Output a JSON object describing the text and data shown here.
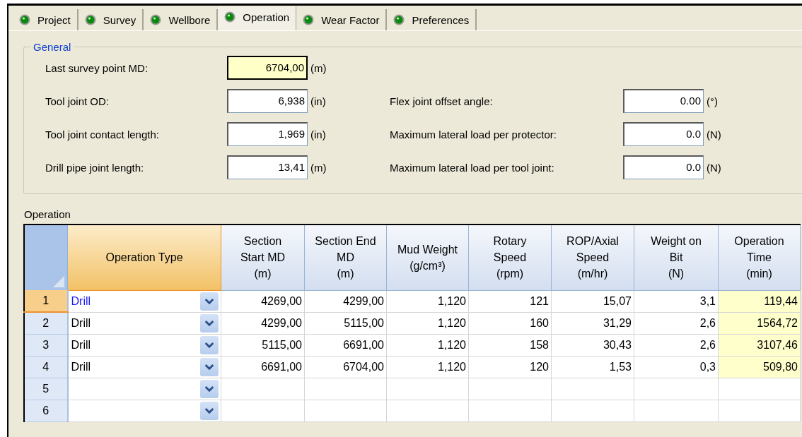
{
  "tabs": [
    {
      "label": "Project",
      "selected": false
    },
    {
      "label": "Survey",
      "selected": false
    },
    {
      "label": "Wellbore",
      "selected": false
    },
    {
      "label": "Operation",
      "selected": true
    },
    {
      "label": "Wear Factor",
      "selected": false
    },
    {
      "label": "Preferences",
      "selected": false
    }
  ],
  "general": {
    "title": "General",
    "rows": [
      {
        "left": {
          "label": "Last survey point MD:",
          "value": "6704,00",
          "unit": "(m)",
          "readonly": true
        }
      },
      {
        "left": {
          "label": "Tool joint OD:",
          "value": "6,938",
          "unit": "(in)",
          "readonly": false
        },
        "right": {
          "label": "Flex joint offset angle:",
          "value": "0.00",
          "unit": "(°)",
          "readonly": false
        }
      },
      {
        "left": {
          "label": "Tool joint contact length:",
          "value": "1,969",
          "unit": "(in)",
          "readonly": false
        },
        "right": {
          "label": "Maximum lateral load per protector:",
          "value": "0.0",
          "unit": "(N)",
          "readonly": false
        }
      },
      {
        "left": {
          "label": "Drill pipe joint length:",
          "value": "13,41",
          "unit": "(m)",
          "readonly": false
        },
        "right": {
          "label": "Maximum lateral load per tool joint:",
          "value": "0.0",
          "unit": "(N)",
          "readonly": false
        }
      }
    ]
  },
  "operation": {
    "title": "Operation",
    "columns": [
      {
        "label": "Operation Type",
        "kind": "combo",
        "selected": true
      },
      {
        "label": "Section\nStart  MD\n(m)",
        "kind": "number",
        "selected": false
      },
      {
        "label": "Section End\nMD\n(m)",
        "kind": "number",
        "selected": false
      },
      {
        "label": "Mud Weight\n(g/cm³)",
        "kind": "number",
        "selected": false
      },
      {
        "label": "Rotary\nSpeed\n(rpm)",
        "kind": "number",
        "selected": false
      },
      {
        "label": "ROP/Axial\nSpeed\n(m/hr)",
        "kind": "number",
        "selected": false
      },
      {
        "label": "Weight on\nBit\n(N)",
        "kind": "number",
        "selected": false
      },
      {
        "label": "Operation\nTime\n(min)",
        "kind": "computed",
        "selected": false
      }
    ],
    "rows": [
      {
        "number": "1",
        "selected": true,
        "cells": [
          "Drill",
          "4269,00",
          "4299,00",
          "1,120",
          "121",
          "15,07",
          "3,1",
          "119,44"
        ]
      },
      {
        "number": "2",
        "selected": false,
        "cells": [
          "Drill",
          "4299,00",
          "5115,00",
          "1,120",
          "160",
          "31,29",
          "2,6",
          "1564,72"
        ]
      },
      {
        "number": "3",
        "selected": false,
        "cells": [
          "Drill",
          "5115,00",
          "6691,00",
          "1,120",
          "158",
          "30,43",
          "2,6",
          "3107,46"
        ]
      },
      {
        "number": "4",
        "selected": false,
        "cells": [
          "Drill",
          "6691,00",
          "6704,00",
          "1,120",
          "120",
          "1,53",
          "0,3",
          "509,80"
        ]
      },
      {
        "number": "5",
        "selected": false,
        "cells": []
      },
      {
        "number": "6",
        "selected": false,
        "cells": []
      }
    ]
  }
}
